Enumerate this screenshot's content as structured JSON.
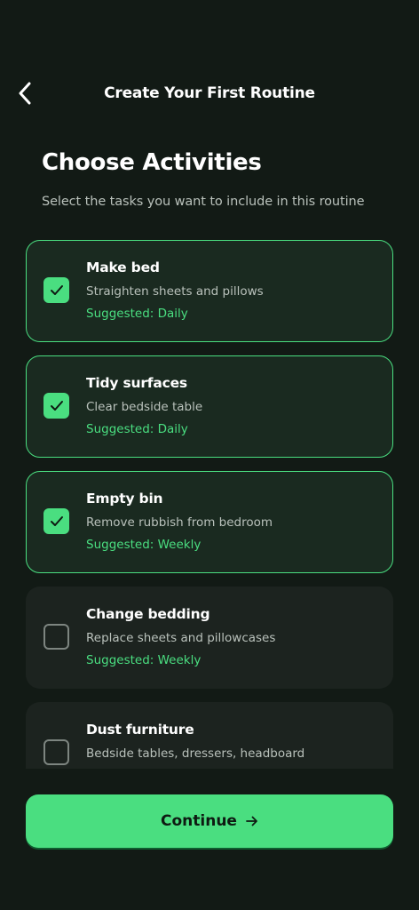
{
  "header": {
    "title": "Create Your First Routine",
    "back_icon": "chevron-left-icon"
  },
  "intro": {
    "title": "Choose Activities",
    "subtitle": "Select the tasks you want to include in this routine"
  },
  "activities": [
    {
      "title": "Make bed",
      "description": "Straighten sheets and pillows",
      "suggestion": "Suggested: Daily",
      "selected": true
    },
    {
      "title": "Tidy surfaces",
      "description": "Clear bedside table",
      "suggestion": "Suggested: Daily",
      "selected": true
    },
    {
      "title": "Empty bin",
      "description": "Remove rubbish from bedroom",
      "suggestion": "Suggested: Weekly",
      "selected": true
    },
    {
      "title": "Change bedding",
      "description": "Replace sheets and pillowcases",
      "suggestion": "Suggested: Weekly",
      "selected": false
    },
    {
      "title": "Dust furniture",
      "description": "Bedside tables, dressers, headboard",
      "suggestion": "",
      "selected": false
    }
  ],
  "footer": {
    "continue_label": "Continue",
    "continue_icon": "arrow-right-icon"
  },
  "colors": {
    "background": "#121a15",
    "accent": "#4ade80",
    "card": "#1c231f",
    "card_selected": "#1a2a20"
  }
}
